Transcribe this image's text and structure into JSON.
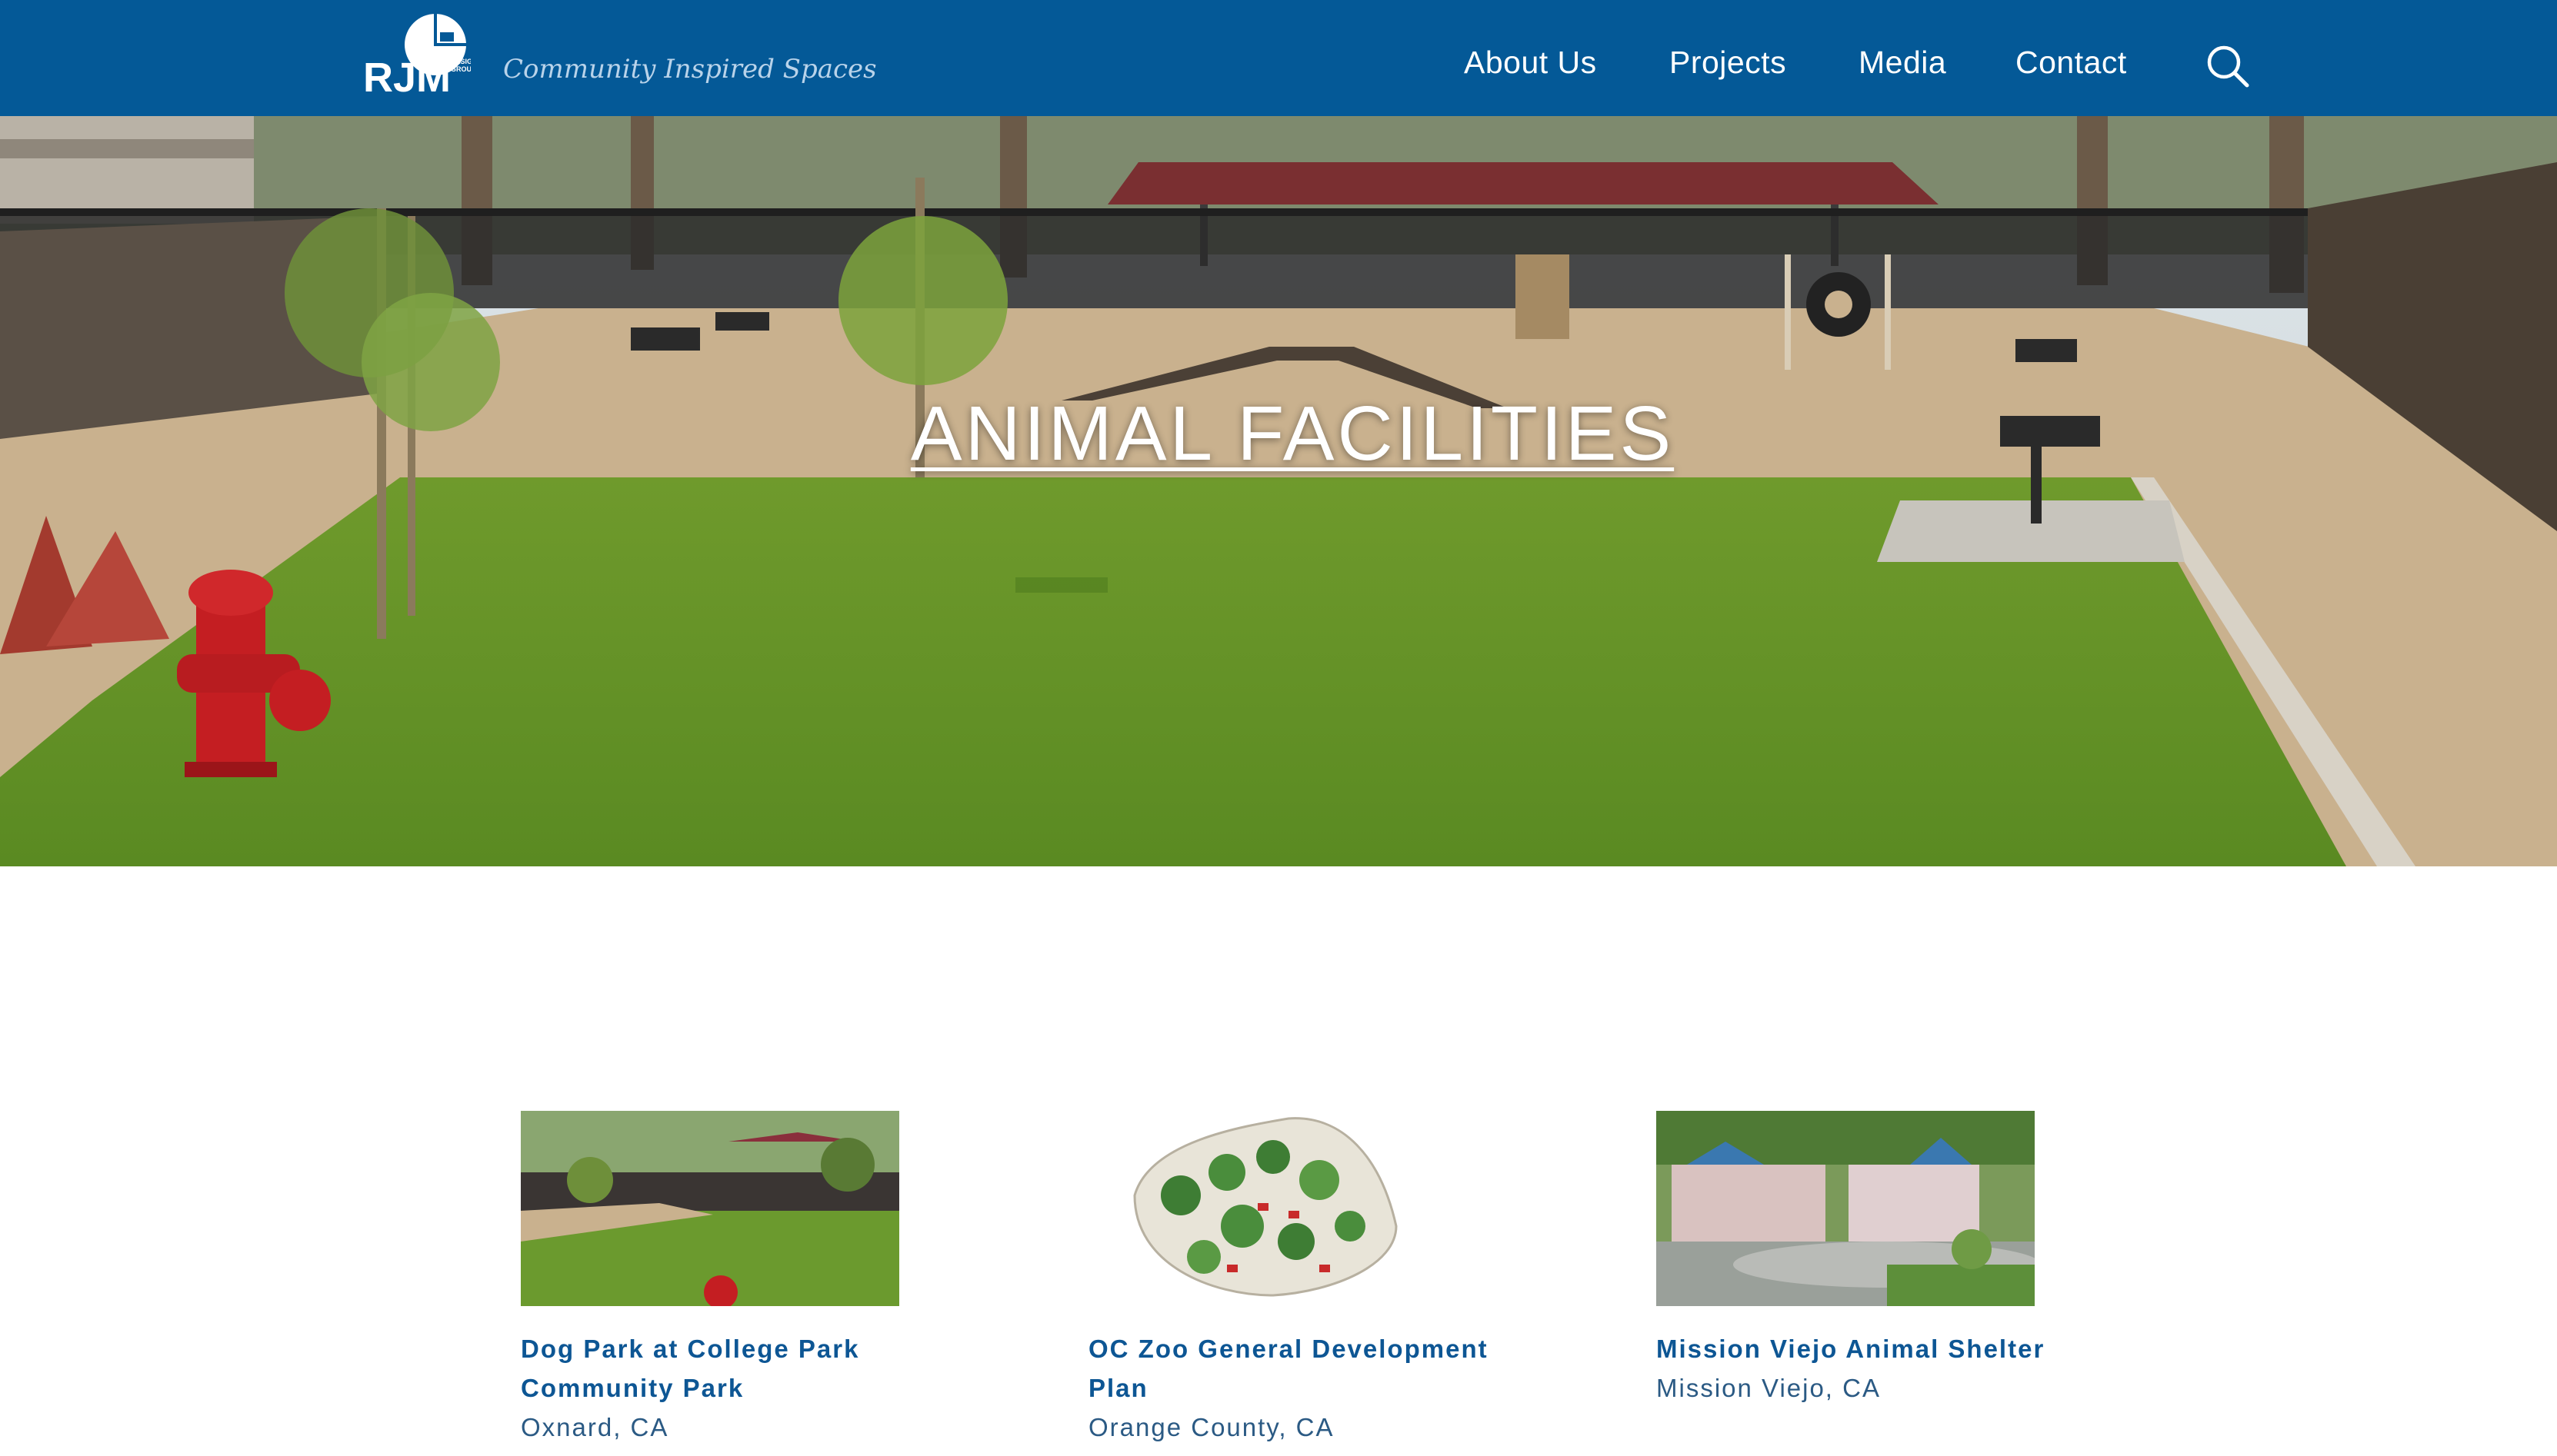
{
  "header": {
    "logo_text": "RJM",
    "logo_subtext": "DESIGN GROUP",
    "tagline": "Community Inspired Spaces",
    "nav": [
      {
        "label": "About Us"
      },
      {
        "label": "Projects"
      },
      {
        "label": "Media"
      },
      {
        "label": "Contact"
      }
    ],
    "search_icon": "search-icon"
  },
  "hero": {
    "title": "ANIMAL FACILITIES",
    "image": "dog park with lawn, benches, fire hydrant and agility ramp"
  },
  "projects": [
    {
      "title": "Dog Park at College Park Community Park",
      "location": "Oxnard, CA"
    },
    {
      "title": "OC Zoo General Development Plan",
      "location": "Orange County, CA"
    },
    {
      "title": "Mission Viejo Animal Shelter",
      "location": "Mission Viejo, CA"
    }
  ],
  "colors": {
    "header": "#045997",
    "link": "#0d5694",
    "tagline": "#b9d3ea"
  }
}
